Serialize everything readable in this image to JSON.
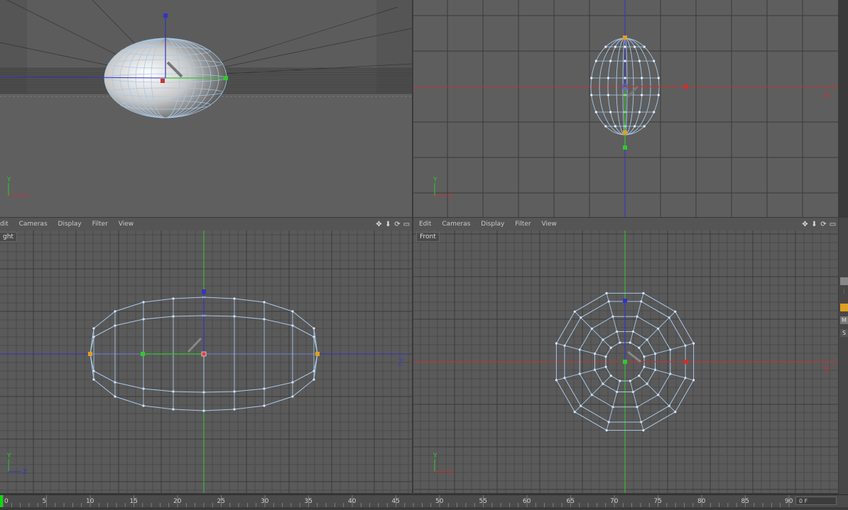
{
  "viewports": {
    "perspective": {},
    "top": {},
    "right": {
      "menu": [
        "dit",
        "Cameras",
        "Display",
        "Filter",
        "View"
      ],
      "label": "ght",
      "axis_label": "Z"
    },
    "front": {
      "menu": [
        "Edit",
        "Cameras",
        "Display",
        "Filter",
        "View"
      ],
      "label": "Front",
      "axis_label": "X"
    },
    "top_axis_label": "X"
  },
  "nav_icons": [
    "move-icon",
    "zoom-icon",
    "rotate-icon",
    "maximize-icon"
  ],
  "timeline": {
    "ticks": [
      "0",
      "5",
      "10",
      "15",
      "20",
      "25",
      "30",
      "35",
      "40",
      "45",
      "50",
      "55",
      "60",
      "65",
      "70",
      "75",
      "80",
      "85",
      "90"
    ],
    "current_frame": "0 F"
  },
  "sidebar_buttons": [
    "M",
    "S"
  ],
  "colors": {
    "x_axis": "#c83232",
    "y_axis": "#32c832",
    "z_axis": "#3232c8",
    "wire": "#a8c8e8",
    "grid": "#2e2e2e"
  }
}
